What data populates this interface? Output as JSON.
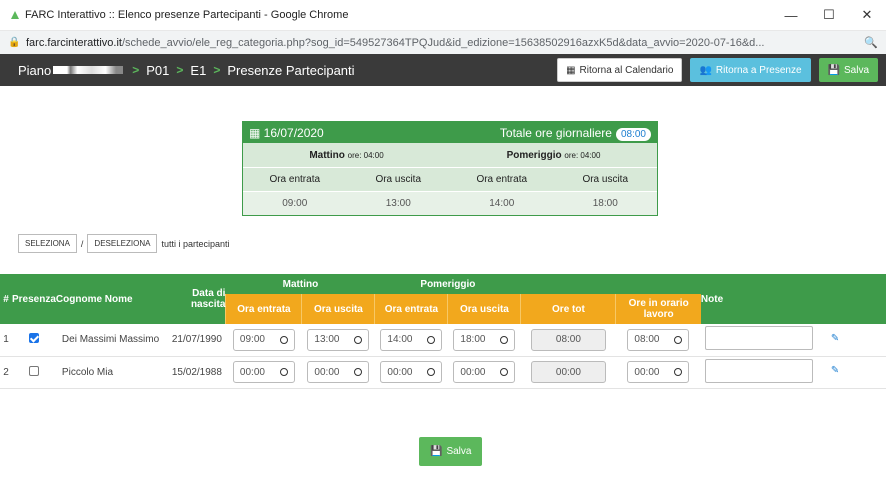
{
  "window": {
    "title": "FARC Interattivo :: Elenco presenze Partecipanti - Google Chrome",
    "url_host": "farc.farcinterattivo.it",
    "url_path": "/schede_avvio/ele_reg_categoria.php?sog_id=549527364TPQJud&id_edizione=15638502916azxK5d&data_avvio=2020-07-16&d..."
  },
  "nav": {
    "piano": "Piano",
    "p01": "P01",
    "e1": "E1",
    "page": "Presenze Partecipanti",
    "btn_calendario": "Ritorna al Calendario",
    "btn_presenze": "Ritorna a Presenze",
    "btn_salva": "Salva"
  },
  "day": {
    "date": "16/07/2020",
    "totale_label": "Totale ore giornaliere",
    "totale": "08:00",
    "mattino_label": "Mattino",
    "mattino_ore": "ore: 04:00",
    "pomeriggio_label": "Pomeriggio",
    "pomeriggio_ore": "ore: 04:00",
    "cols": [
      "Ora entrata",
      "Ora uscita",
      "Ora entrata",
      "Ora uscita"
    ],
    "vals": [
      "09:00",
      "13:00",
      "14:00",
      "18:00"
    ]
  },
  "select": {
    "seleziona": "SELEZIONA",
    "slash": "/",
    "deseleziona": "DESELEZIONA",
    "tail": "tutti i partecipanti"
  },
  "table": {
    "h_num": "#",
    "h_presenza": "Presenza",
    "h_nome": "Cognome Nome",
    "h_data": "Data di nascita",
    "h_mattino": "Mattino",
    "h_pomeriggio": "Pomeriggio",
    "h_note": "Note",
    "sub": [
      "Ora entrata",
      "Ora uscita",
      "Ora entrata",
      "Ora uscita",
      "Ore tot",
      "Ore in orario lavoro"
    ],
    "rows": [
      {
        "n": "1",
        "checked": true,
        "nome": "Dei Massimi Massimo",
        "data": "21/07/1990",
        "t": [
          "09:00",
          "13:00",
          "14:00",
          "18:00"
        ],
        "tot": "08:00",
        "lavoro": "08:00"
      },
      {
        "n": "2",
        "checked": false,
        "nome": "Piccolo Mia",
        "data": "15/02/1988",
        "t": [
          "00:00",
          "00:00",
          "00:00",
          "00:00"
        ],
        "tot": "00:00",
        "lavoro": "00:00"
      }
    ]
  },
  "footer": {
    "salva": "Salva"
  },
  "colors": {
    "green": "#3e9b4a",
    "orange": "#f2a81d",
    "dark": "#3a3a3a",
    "blue": "#5bc0de"
  }
}
